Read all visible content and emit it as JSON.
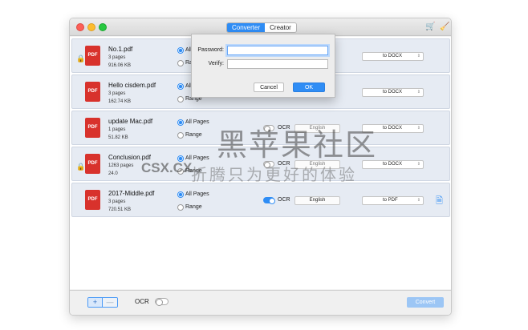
{
  "tabs": {
    "converter": "Converter",
    "creator": "Creator"
  },
  "toolbar_icons": {
    "cart": "cart-icon",
    "brush": "brush-icon"
  },
  "colors": {
    "accent": "#2f8df5",
    "pdf_red": "#d8322c",
    "row_bg": "#e6ebf3"
  },
  "files": [
    {
      "name": "No.1.pdf",
      "pages": "3 pages",
      "size": "916.06 KB",
      "locked": true,
      "opt_all": "All P",
      "opt_range": "Rang",
      "format": "to DOCX",
      "pdf_label": "PDF"
    },
    {
      "name": "Hello cisdem.pdf",
      "pages": "3 pages",
      "size": "162.74 KB",
      "locked": false,
      "opt_all": "All P",
      "opt_range": "Range",
      "format": "to DOCX",
      "pdf_label": "PDF"
    },
    {
      "name": "update Mac.pdf",
      "pages": "1 pages",
      "size": "51.82 KB",
      "locked": false,
      "opt_all": "All Pages",
      "opt_range": "Range",
      "ocr": "OCR",
      "language": "English",
      "format": "to DOCX",
      "pdf_label": "PDF"
    },
    {
      "name": "Conclusion.pdf",
      "pages": "1263 pages",
      "size": "24.0",
      "locked": true,
      "opt_all": "All Pages",
      "opt_range": "Range",
      "ocr": "OCR",
      "language": "English",
      "format": "to DOCX",
      "pdf_label": "PDF"
    },
    {
      "name": "2017-Middle.pdf",
      "pages": "3 pages",
      "size": "720.51 KB",
      "locked": false,
      "opt_all": "All Pages",
      "opt_range": "Range",
      "ocr": "OCR",
      "language": "English",
      "format": "to PDF",
      "pdf_label": "PDF"
    }
  ],
  "dialog": {
    "password_label": "Password:",
    "verify_label": "Verify:",
    "cancel": "Cancel",
    "ok": "OK"
  },
  "footer": {
    "plus": "+",
    "minus": "—",
    "ocr": "OCR",
    "convert": "Convert"
  },
  "watermark": {
    "chinese": "黑苹果社区",
    "site": "CSX.CX",
    "subtitle": "折腾只为更好的体验"
  }
}
